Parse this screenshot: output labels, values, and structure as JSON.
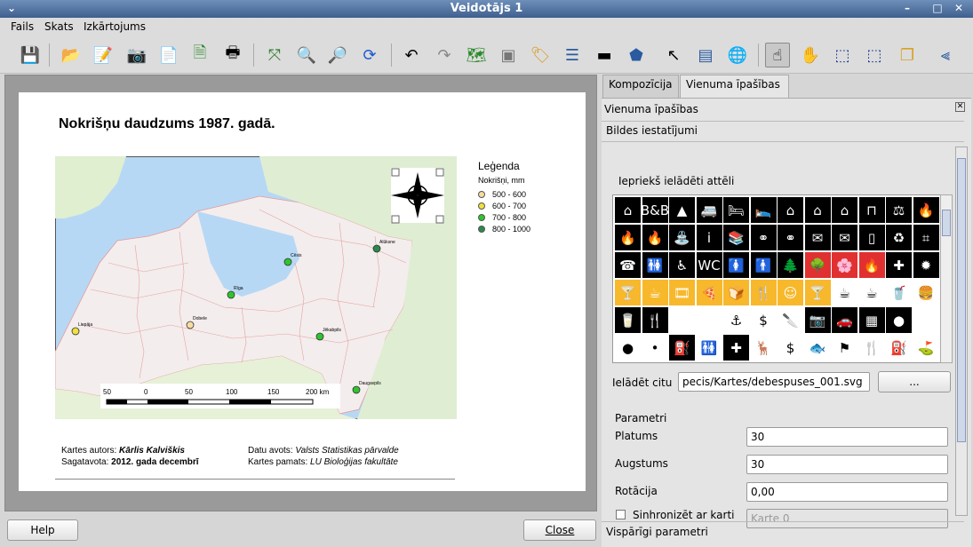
{
  "window": {
    "title": "Veidotājs 1"
  },
  "menu": {
    "items": [
      "Fails",
      "Skats",
      "Izkārtojums"
    ]
  },
  "toolbar": {
    "icons": [
      "save-icon",
      "open-template-icon",
      "save-template-icon",
      "export-image-icon",
      "export-pdf-icon",
      "export-svg-icon",
      "print-icon",
      "zoom-full-icon",
      "zoom-in-icon",
      "zoom-out-icon",
      "refresh-icon",
      "undo-icon",
      "redo-icon",
      "add-map-icon",
      "add-image-icon",
      "add-label-icon",
      "add-legend-icon",
      "add-scalebar-icon",
      "add-shape-icon",
      "add-arrow-icon",
      "add-table-icon",
      "add-html-icon",
      "select-icon",
      "move-content-icon",
      "group-icon",
      "ungroup-icon",
      "raise-icon",
      "align-icon"
    ]
  },
  "composition": {
    "title": "Nokrišņu daudzums 1987. gadā.",
    "legend": {
      "title": "Leģenda",
      "subtitle": "Nokrišņi, mm",
      "items": [
        {
          "label": "500 - 600",
          "color": "#f6dca0"
        },
        {
          "label": "600 - 700",
          "color": "#f0e040"
        },
        {
          "label": "700 - 800",
          "color": "#2ec42e"
        },
        {
          "label": "800 - 1000",
          "color": "#2a8a4a"
        }
      ]
    },
    "scalebar": {
      "labels": [
        "50",
        "0",
        "50",
        "100",
        "150",
        "200 km"
      ]
    },
    "cities": [
      {
        "name": "Liepāja",
        "color": "#f0e040"
      },
      {
        "name": "Dobele",
        "color": "#f6dca0"
      },
      {
        "name": "Rīga",
        "color": "#2ec42e"
      },
      {
        "name": "Cēsis",
        "color": "#2ec42e"
      },
      {
        "name": "Alūksne",
        "color": "#2a8a4a"
      },
      {
        "name": "Jēkabpils",
        "color": "#2ec42e"
      },
      {
        "name": "Daugavpils",
        "color": "#2ec42e"
      }
    ],
    "footer": {
      "author_label": "Kartes autors:",
      "author": "Kārlis Kalviškis",
      "prepared_label": "Sagatavota:",
      "prepared": "2012. gada decembrī",
      "source_label": "Datu avots:",
      "source": "Valsts Statistikas pārvalde",
      "base_label": "Kartes pamats:",
      "base": "LU Bioloģijas fakultāte"
    }
  },
  "buttons": {
    "help": "Help",
    "close": "Close"
  },
  "panel": {
    "tabs": [
      "Kompozīcija",
      "Vienuma īpašības"
    ],
    "header": "Vienuma īpašības",
    "section": "Bildes iestatījumi",
    "preloaded_label": "Iepriekš ielādēti attēli",
    "load_other_label": "Ielādēt citu",
    "load_path": "pecis/Kartes/debespuses_001.svg",
    "browse_label": "...",
    "params_label": "Parametri",
    "width_label": "Platums",
    "width_value": "30",
    "height_label": "Augstums",
    "height_value": "30",
    "rotation_label": "Rotācija",
    "rotation_value": "0,00",
    "sync_label": "Sinhronizēt ar karti",
    "map_select": "Karte 0",
    "general_label": "Vispārīgi parametri"
  }
}
